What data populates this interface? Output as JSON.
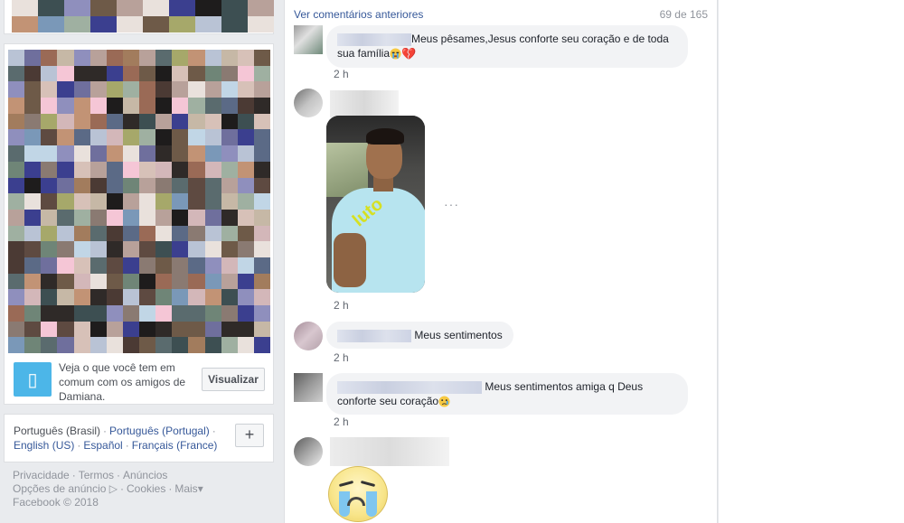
{
  "left": {
    "mutual_text": "Veja o que você tem em comum com os amigos de Damiana.",
    "visualizar_label": "Visualizar",
    "languages": {
      "current": "Português (Brasil)",
      "others": [
        "Português (Portugal)",
        "English (US)",
        "Español",
        "Français (France)"
      ],
      "add_label": "+"
    },
    "footer": {
      "links_line1": [
        "Privacidade",
        "Termos",
        "Anúncios"
      ],
      "links_line2": [
        "Opções de anúncio",
        "Cookies",
        "Mais"
      ],
      "ad_choices_glyph": "▷",
      "more_glyph": "▾",
      "copyright": "Facebook © 2018"
    }
  },
  "feed": {
    "more_comments_label": "Ver comentários anteriores",
    "count": "69 de 165",
    "comments": [
      {
        "text_line1": "Meus pêsames,Jesus conforte seu coração e de toda",
        "text_line2": "sua família",
        "emoji1": "crying-face",
        "emoji2": "broken-heart",
        "time": "2 h"
      },
      {
        "photo_overlay": "luto",
        "more": "···",
        "time": "2 h"
      },
      {
        "text": "Meus sentimentos",
        "time": "2 h"
      },
      {
        "text_line1": "Meus sentimentos amiga q Deus",
        "text_line2": "conforte seu coração",
        "emoji": "sad-face",
        "time": "2 h"
      },
      {
        "sticker": "crying-sticker"
      }
    ]
  },
  "colors": {
    "link": "#365899",
    "bubble": "#f2f3f5",
    "page_bg": "#e9ebee",
    "muted": "#90949c"
  }
}
